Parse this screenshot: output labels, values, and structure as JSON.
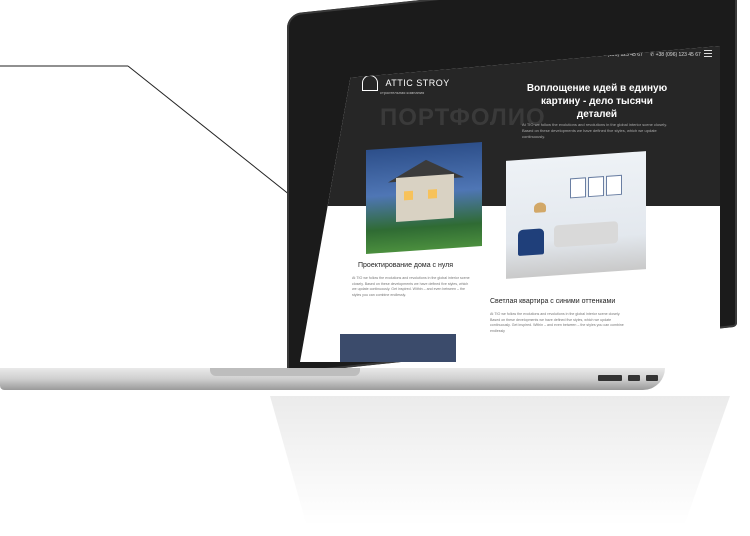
{
  "site": {
    "logo_name": "ATTIC STROY",
    "logo_sub": "строительная компания",
    "phone_1": "+38 (096) 123 45 67",
    "phone_2": "+38 (096) 123 45 67",
    "section_title": "ПОРТФОЛИО",
    "hero_title": "Воплощение идей в единую картину - дело тысячи деталей",
    "hero_text": "At TIO we follow the evolutions and revolutions in the global interior scene closely. Based on these developments we have defined five styles, which we update continuously."
  },
  "cards": [
    {
      "title": "Проектирование дома с нуля",
      "text": "At TIO we follow the evolutions and revolutions in the global interior scene closely. Based on these developments we have defined five styles, which we update continuously. Get inspired. Within – and even between – the styles you can combine endlessly."
    },
    {
      "title": "Светлая квартира с синими оттенками",
      "text": "At TIO we follow the evolutions and revolutions in the global interior scene closely. Based on these developments we have defined five styles, which we update continuously. Get inspired. Within – and even between – the styles you can combine endlessly"
    }
  ],
  "colors": {
    "screen_dark": "#262626",
    "chair_blue": "#1f3f7a"
  },
  "icons": [
    "logo-icon",
    "phone-icon",
    "menu-icon"
  ]
}
